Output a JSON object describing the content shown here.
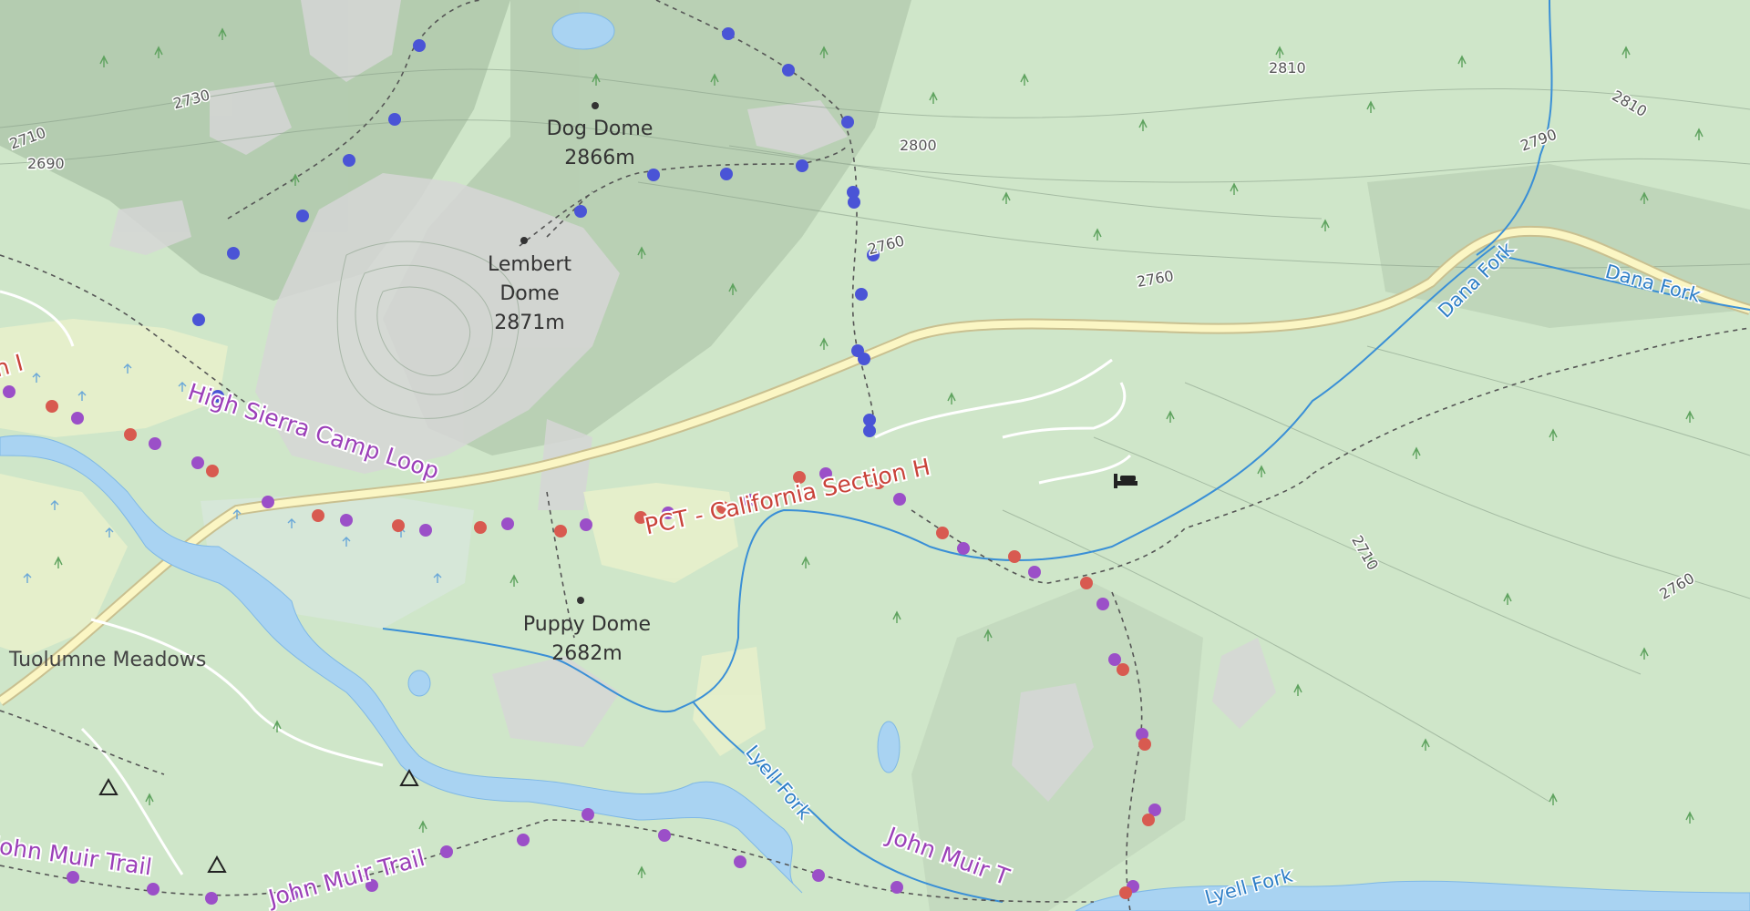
{
  "map": {
    "colors": {
      "land": "#cfe6c9",
      "rock": "#d9d9d9",
      "water": "#a9d3f2",
      "river": "#3a8fd6",
      "road_fill": "#fbf6c4",
      "road_casing": "#c9c090",
      "trail_purple": "#9b4fc8",
      "trail_red": "#d85a50",
      "trail_blue": "#4a54d6",
      "meadow": "#e6efc8"
    },
    "peaks": [
      {
        "name": "Dog Dome",
        "elevation": "2866m"
      },
      {
        "name": "Lembert",
        "name2": "Dome",
        "elevation": "2871m"
      },
      {
        "name": "Puppy Dome",
        "elevation": "2682m"
      }
    ],
    "places": {
      "tuolumne": "Tuolumne Meadows",
      "partial_left": "n I"
    },
    "trails": {
      "high_sierra": "High Sierra Camp Loop",
      "pct": "PCT - California Section H",
      "jmt_left": "John Muir Trail",
      "jmt_center": "John Muir Trail",
      "jmt_right": "John Muir T"
    },
    "water": {
      "dana_fork_1": "Dana Fork",
      "dana_fork_2": "Dana Fork",
      "lyell_fork_1": "Lyell Fork",
      "lyell_fork_2": "Lyell Fork"
    },
    "contours": {
      "c2730": "2730",
      "c2710": "2710",
      "c2690": "2690",
      "c2810a": "2810",
      "c2810b": "2810",
      "c2790": "2790",
      "c2800": "2800",
      "c2760a": "2760",
      "c2760b": "2760",
      "c2710b": "2710",
      "c2760c": "2760"
    },
    "icons": {
      "lodging": "bed-icon",
      "campsite": "campsite-icon"
    }
  }
}
